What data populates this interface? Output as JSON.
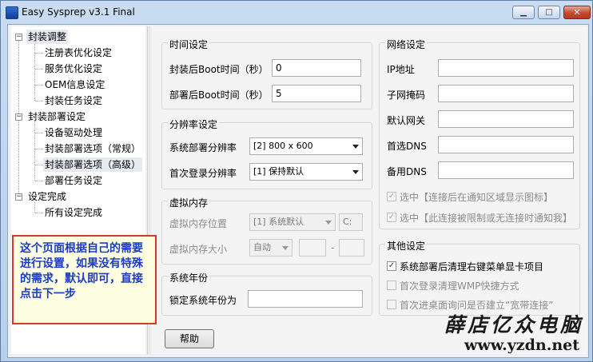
{
  "window": {
    "title": "Easy Sysprep v3.1 Final",
    "min": "▁",
    "max": "□",
    "close": "✕"
  },
  "tree": {
    "items": [
      {
        "label": "封装调整",
        "expander": "−"
      },
      {
        "label": "注册表优化设定"
      },
      {
        "label": "服务优化设定"
      },
      {
        "label": "OEM信息设定"
      },
      {
        "label": "封装任务设定"
      },
      {
        "label": "封装部署设定",
        "expander": "−"
      },
      {
        "label": "设备驱动处理"
      },
      {
        "label": "封装部署选项（常规）"
      },
      {
        "label": "封装部署选项（高级）"
      },
      {
        "label": "部署任务设定"
      },
      {
        "label": "设定完成",
        "expander": "−"
      },
      {
        "label": "所有设定完成"
      }
    ]
  },
  "time_settings": {
    "title": "时间设定",
    "seal_boot_label": "封装后Boot时间（秒）",
    "seal_boot_value": "0",
    "deploy_boot_label": "部署后Boot时间（秒）",
    "deploy_boot_value": "5"
  },
  "resolution": {
    "title": "分辨率设定",
    "deploy_label": "系统部署分辨率",
    "deploy_value": "[2] 800 x 600",
    "login_label": "首次登录分辨率",
    "login_value": "[1] 保持默认"
  },
  "virtual_memory": {
    "title": "虚拟内存",
    "location_label": "虚拟内存位置",
    "location_value": "[1] 系统默认",
    "drive_value": "C:",
    "size_label": "虚拟内存大小",
    "size_value": "自动",
    "separator": "-"
  },
  "system_year": {
    "title": "系统年份",
    "lock_label": "锁定系统年份为",
    "lock_value": ""
  },
  "network": {
    "title": "网络设定",
    "ip_label": "IP地址",
    "mask_label": "子网掩码",
    "gateway_label": "默认网关",
    "dns1_label": "首选DNS",
    "dns2_label": "备用DNS",
    "option1": "选中【连接后在通知区域显示图标】",
    "option2": "选中【此连接被限制或无连接时通知我】",
    "check_mark": "✓"
  },
  "other": {
    "title": "其他设定",
    "option1": "系统部署后清理右键菜单显卡项目",
    "option2": "首次登录清理WMP快捷方式",
    "option3": "首次进桌面询问是否建立“宽带连接”",
    "check_mark": "✓"
  },
  "help_button": "帮助",
  "note": "这个页面根据自己的需要进行设置，如果没有特殊的需求，默认即可，直接点击下一步",
  "watermark": {
    "line1": "薛店亿众电脑",
    "line2": "www.yzdn.net"
  }
}
